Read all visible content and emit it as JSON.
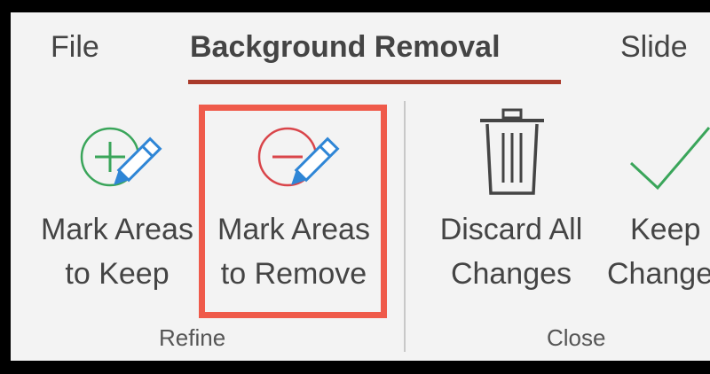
{
  "tabs": [
    {
      "label": "File"
    },
    {
      "label": "Background Removal",
      "active": true
    },
    {
      "label": "Slide"
    }
  ],
  "commands": {
    "mark_keep": {
      "line1": "Mark Areas",
      "line2": "to Keep"
    },
    "mark_remove": {
      "line1": "Mark Areas",
      "line2": "to Remove"
    },
    "discard": {
      "line1": "Discard All",
      "line2": "Changes"
    },
    "keep_changes": {
      "line1": "Keep",
      "line2": "Changes"
    }
  },
  "groups": {
    "refine": "Refine",
    "close": "Close"
  },
  "icons": {
    "mark_keep": "plus-pencil-icon",
    "mark_remove": "minus-pencil-icon",
    "discard": "trash-icon",
    "keep_changes": "checkmark-icon"
  },
  "colors": {
    "accent_underline": "#a93a2a",
    "highlight_box": "#ef5a4a",
    "keep_green": "#3aa55a",
    "remove_red": "#d9454a",
    "pencil_blue": "#2f86d6"
  }
}
